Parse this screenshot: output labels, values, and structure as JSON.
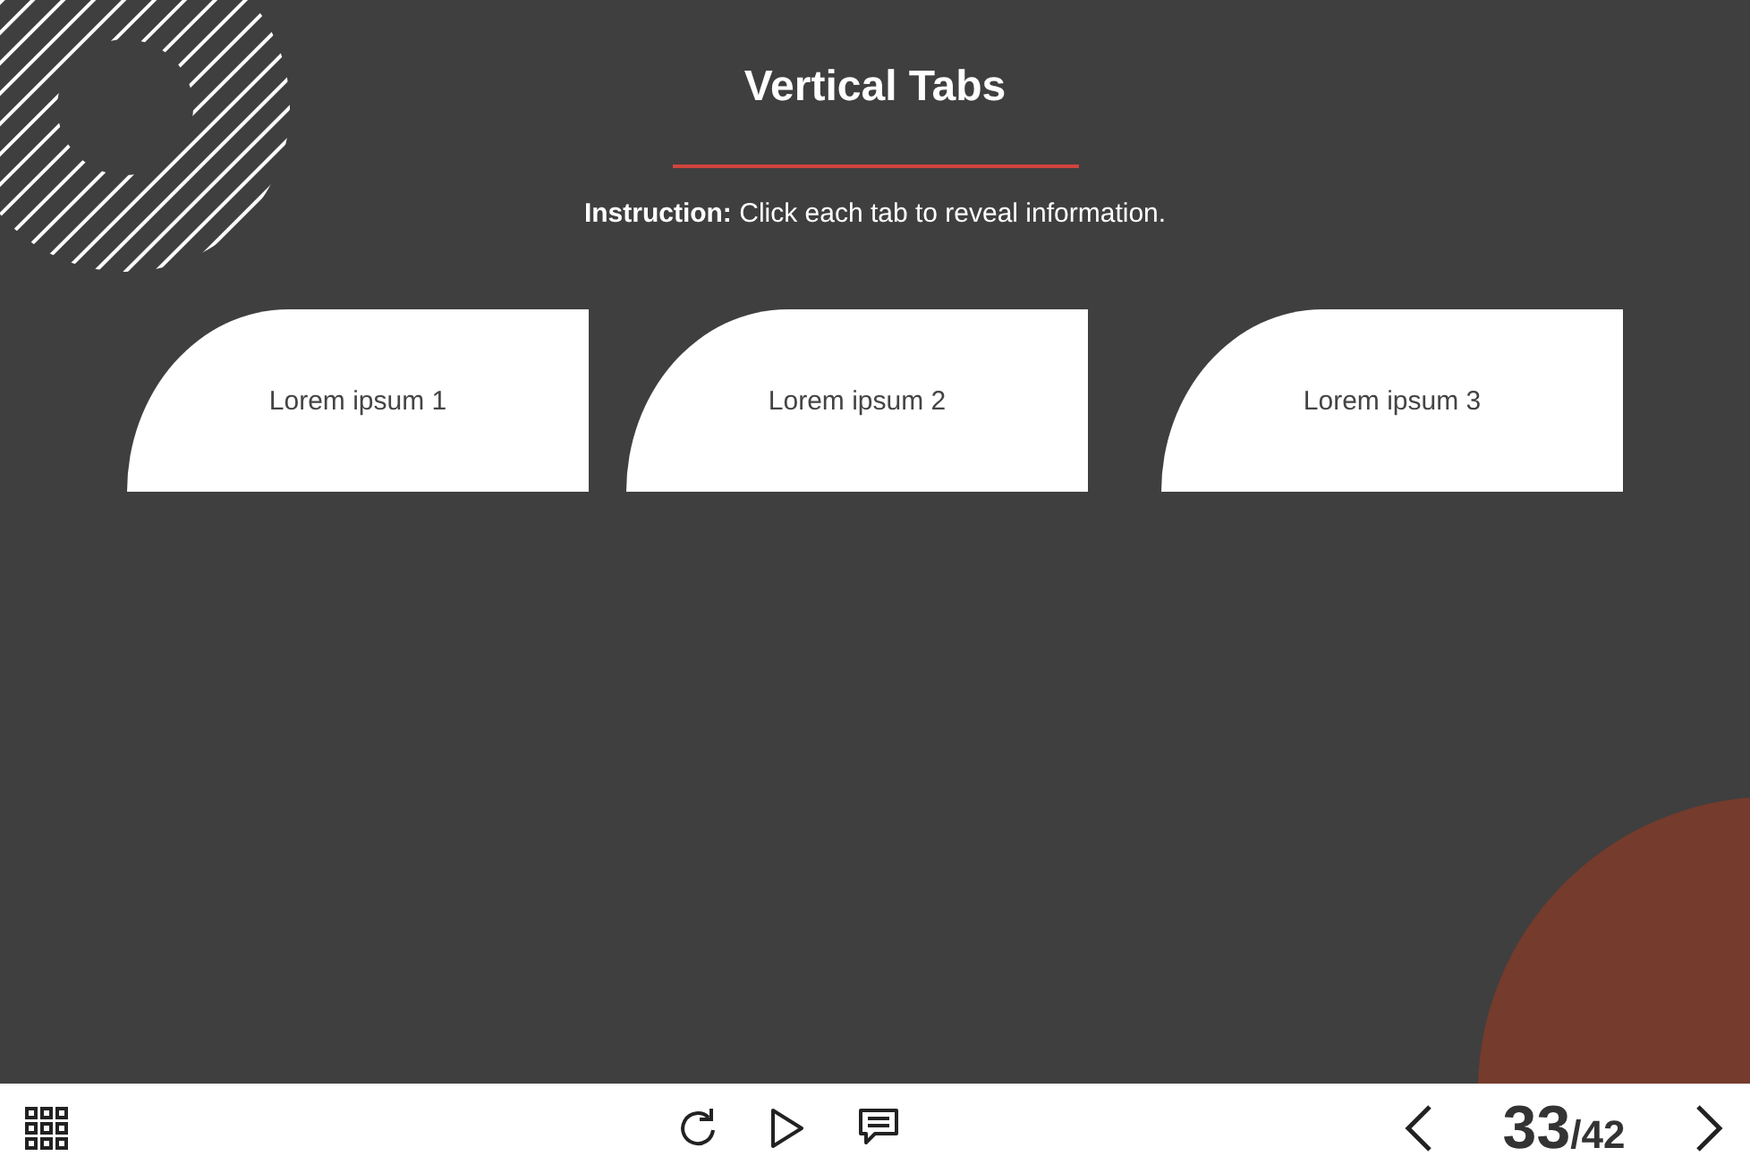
{
  "slide": {
    "title": "Vertical Tabs",
    "instruction": "**Instruction:** Click each tab to reveal information.",
    "tabs": [
      {
        "label": "Lorem ipsum 1"
      },
      {
        "label": "Lorem ipsum 2"
      },
      {
        "label": "Lorem ipsum 3"
      }
    ]
  },
  "player_bar": {
    "current_slide": "33",
    "total_slides": "/42"
  }
}
